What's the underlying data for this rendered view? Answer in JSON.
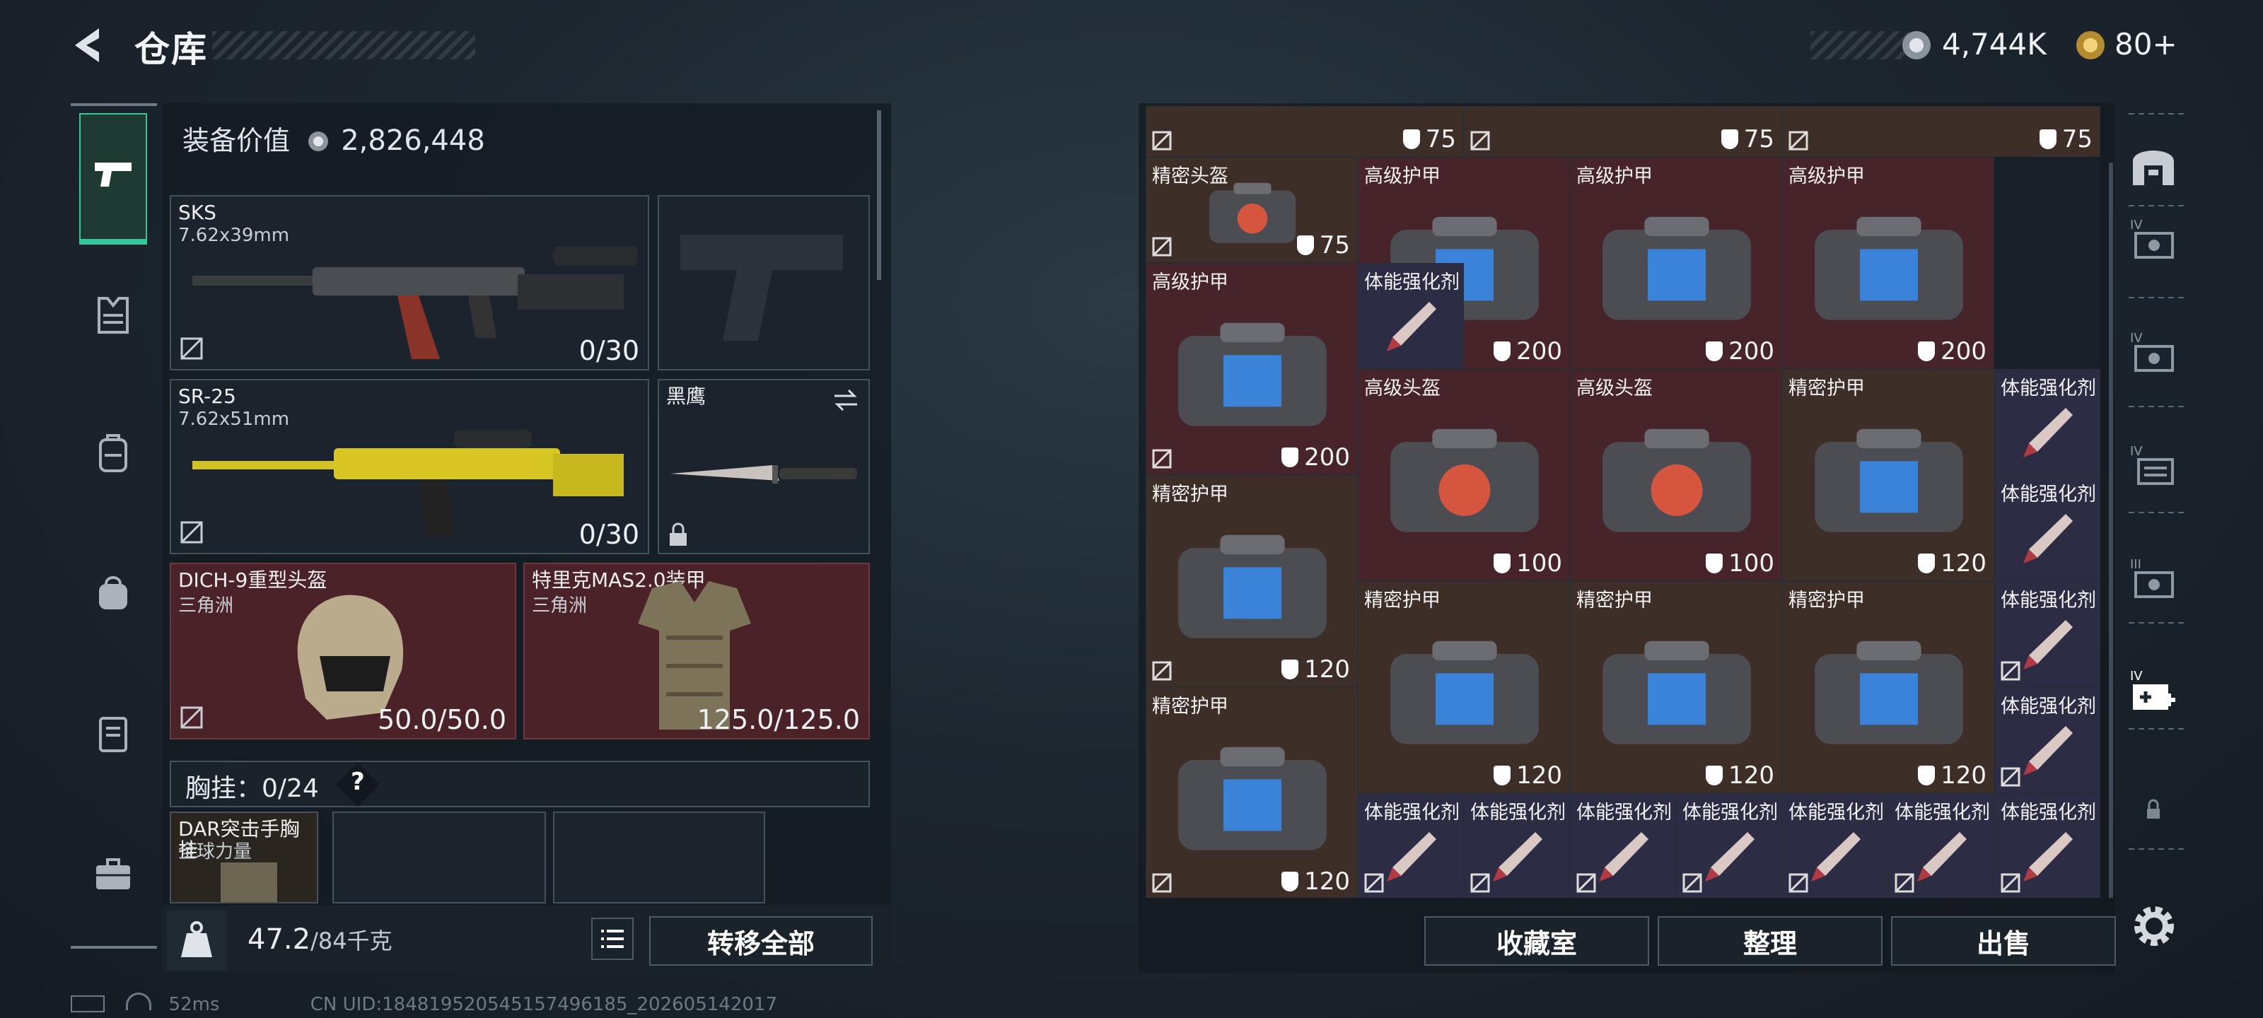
{
  "header": {
    "title": "仓库",
    "currency1": "4,744K",
    "currency2": "80+"
  },
  "loadout": {
    "value_label": "装备价值",
    "value": "2,826,448",
    "primary": {
      "name": "SKS",
      "caliber": "7.62x39mm",
      "ammo": "0/30"
    },
    "secondary": {
      "name": "SR-25",
      "caliber": "7.62x51mm",
      "ammo": "0/30"
    },
    "melee": {
      "name": "黑鹰"
    },
    "helmet": {
      "name": "DICH-9重型头盔",
      "origin": "三角洲",
      "durability": "50.0/50.0"
    },
    "armor": {
      "name": "特里克MAS2.0装甲",
      "origin": "三角洲",
      "durability": "125.0/125.0"
    },
    "chest_label": "胸挂：",
    "chest_count": "0/24",
    "chest_help": "?",
    "rig": {
      "name": "DAR突击手胸挂",
      "origin": "全球力量"
    },
    "weight": "47.2",
    "weight_max": "/84千克",
    "transfer_all": "转移全部"
  },
  "stash": {
    "top_row": [
      "75",
      "75",
      "75"
    ],
    "items": [
      {
        "name": "精密头盔",
        "dur": "75"
      },
      {
        "name": "高级护甲",
        "dur": "200"
      },
      {
        "name": "高级护甲",
        "dur": "200"
      },
      {
        "name": "高级护甲",
        "dur": "200"
      },
      {
        "name": "高级护甲",
        "dur": "200"
      },
      {
        "name": "体能强化剂"
      },
      {
        "name": "高级头盔",
        "dur": "100"
      },
      {
        "name": "高级头盔",
        "dur": "100"
      },
      {
        "name": "精密护甲",
        "dur": "120"
      },
      {
        "name": "体能强化剂"
      },
      {
        "name": "精密护甲",
        "dur": "120"
      },
      {
        "name": "体能强化剂"
      },
      {
        "name": "精密护甲",
        "dur": "120"
      },
      {
        "name": "精密护甲",
        "dur": "120"
      },
      {
        "name": "精密护甲",
        "dur": "120"
      },
      {
        "name": "体能强化剂"
      },
      {
        "name": "精密护甲",
        "dur": "120"
      },
      {
        "name": "体能强化剂"
      },
      {
        "name": "体能强化剂"
      },
      {
        "name": "体能强化剂"
      },
      {
        "name": "体能强化剂"
      },
      {
        "name": "体能强化剂"
      },
      {
        "name": "体能强化剂"
      },
      {
        "name": "体能强化剂"
      },
      {
        "name": "体能强化剂"
      }
    ],
    "buttons": {
      "collection": "收藏室",
      "sort": "整理",
      "sell": "出售"
    },
    "side_levels": [
      "IV",
      "IV",
      "IV",
      "III",
      "IV"
    ]
  },
  "status": {
    "ping": "52ms",
    "uid": "CN UID:1848195205451574961​85_202605142017"
  },
  "colors": {
    "accent": "#36c79a",
    "red_slot": "#4a2227",
    "brown_cell": "#3d2f27"
  }
}
